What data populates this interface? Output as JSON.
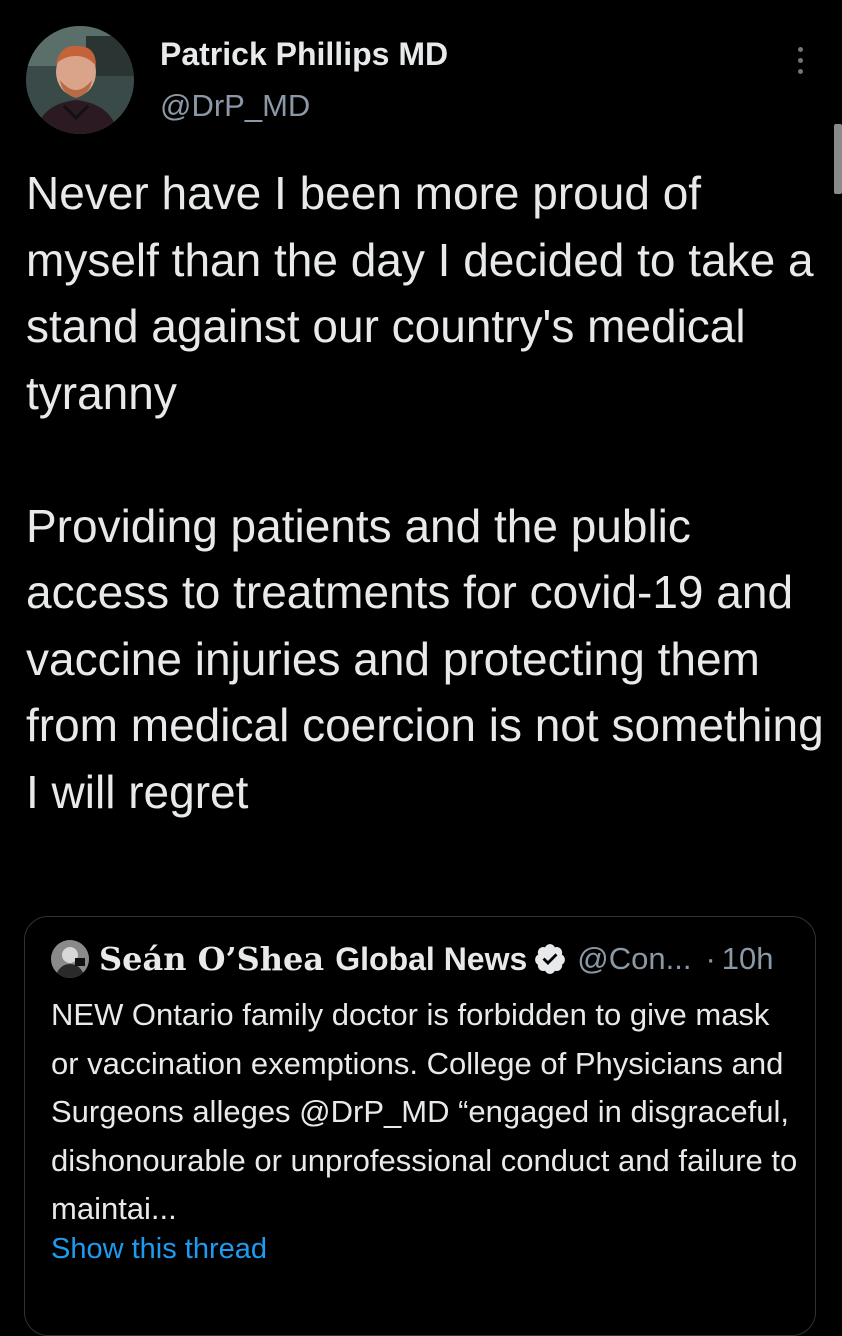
{
  "author": {
    "display_name": "Patrick Phillips MD",
    "handle": "@DrP_MD"
  },
  "tweet": {
    "text": "Never have I been more proud of myself than the day I decided to take a stand against our country's medical tyranny\n\nProviding patients and the public access to treatments for covid-19 and vaccine injuries and protecting them from medical coercion is not something I will regret"
  },
  "quoted_tweet": {
    "display_name_part1": "Seán O’Shea",
    "display_name_part2": "Global News",
    "handle": "@Con...",
    "separator": "·",
    "time": "10h",
    "text": "NEW Ontario family doctor is forbidden to give mask or vaccination exemptions.  College of Physicians and Surgeons alleges @DrP_MD “engaged in disgraceful, dishonourable or unprofessional conduct and failure to maintai...",
    "show_thread_label": "Show this thread",
    "verified_icon": "verified-badge-icon"
  },
  "colors": {
    "background": "#000000",
    "text_primary": "#e7e9ea",
    "text_secondary": "#8b98a5",
    "link": "#1d9bf0",
    "border": "#2f3336"
  }
}
